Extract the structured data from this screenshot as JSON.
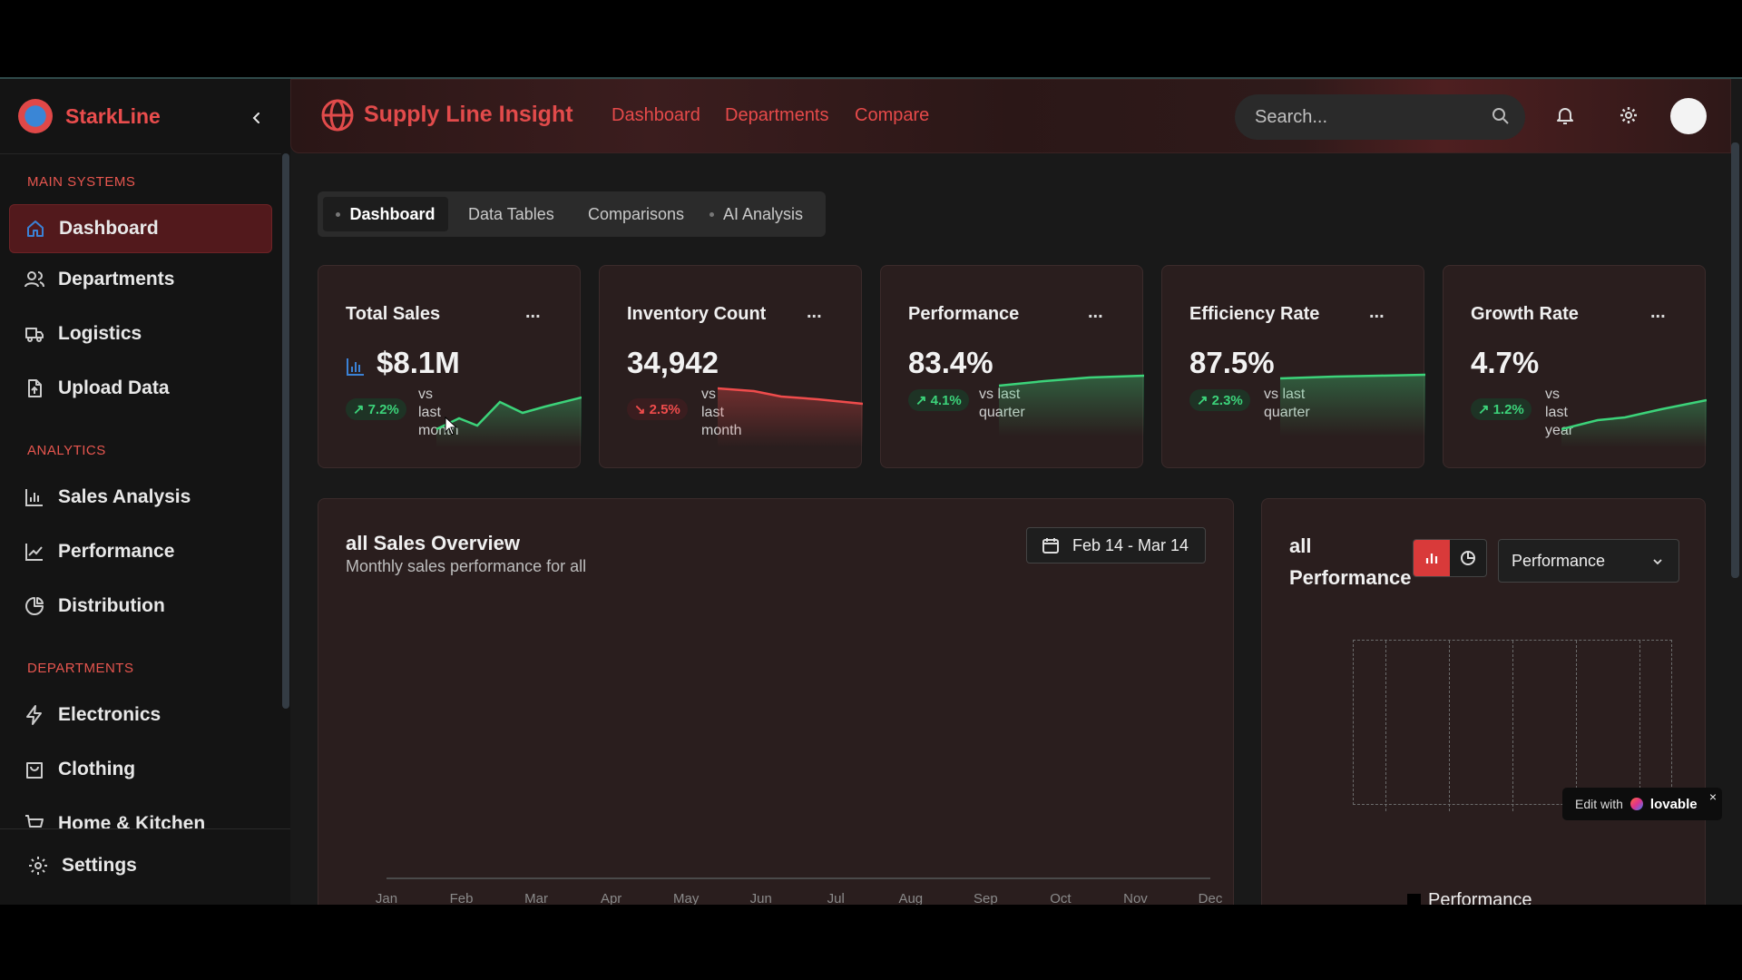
{
  "sidebar": {
    "brand": "StarkLine",
    "sections": {
      "main": "MAIN SYSTEMS",
      "analytics": "ANALYTICS",
      "departments": "DEPARTMENTS"
    },
    "items": {
      "dashboard": "Dashboard",
      "departments": "Departments",
      "logistics": "Logistics",
      "upload": "Upload Data",
      "sales": "Sales Analysis",
      "performance": "Performance",
      "distribution": "Distribution",
      "electronics": "Electronics",
      "clothing": "Clothing",
      "home": "Home & Kitchen"
    },
    "settings": "Settings"
  },
  "header": {
    "title": "Supply Line Insight",
    "links": [
      "Dashboard",
      "Departments",
      "Compare"
    ],
    "search_placeholder": "Search..."
  },
  "tabs": [
    "Dashboard",
    "Data Tables",
    "Comparisons",
    "AI Analysis"
  ],
  "cards": [
    {
      "title": "Total Sales",
      "value": "$8.1M",
      "change": "7.2%",
      "trend": "up",
      "vs": [
        "vs",
        "last",
        "month"
      ]
    },
    {
      "title": "Inventory Count",
      "value": "34,942",
      "change": "2.5%",
      "trend": "down",
      "vs": [
        "vs",
        "last",
        "month"
      ]
    },
    {
      "title": "Performance",
      "value": "83.4%",
      "change": "4.1%",
      "trend": "up",
      "vs": [
        "vs last",
        "quarter"
      ]
    },
    {
      "title": "Efficiency Rate",
      "value": "87.5%",
      "change": "2.3%",
      "trend": "up",
      "vs": [
        "vs last",
        "quarter"
      ]
    },
    {
      "title": "Growth Rate",
      "value": "4.7%",
      "change": "1.2%",
      "trend": "up",
      "vs": [
        "vs",
        "last",
        "year"
      ]
    }
  ],
  "more_label": "...",
  "sales_panel": {
    "title": "all Sales Overview",
    "subtitle": "Monthly sales performance for all",
    "date_range": "Feb 14 - Mar 14",
    "months": [
      "Jan",
      "Feb",
      "Mar",
      "Apr",
      "May",
      "Jun",
      "Jul",
      "Aug",
      "Sep",
      "Oct",
      "Nov",
      "Dec"
    ]
  },
  "perf_panel": {
    "title_line1": "all",
    "title_line2": "Performance",
    "select_value": "Performance",
    "legend": "Performance"
  },
  "lovable": {
    "prefix": "Edit with",
    "brand": "lovable",
    "close": "×"
  },
  "colors": {
    "accent": "#e24b4b",
    "up": "#3cd37a",
    "down": "#ef4c4c"
  }
}
